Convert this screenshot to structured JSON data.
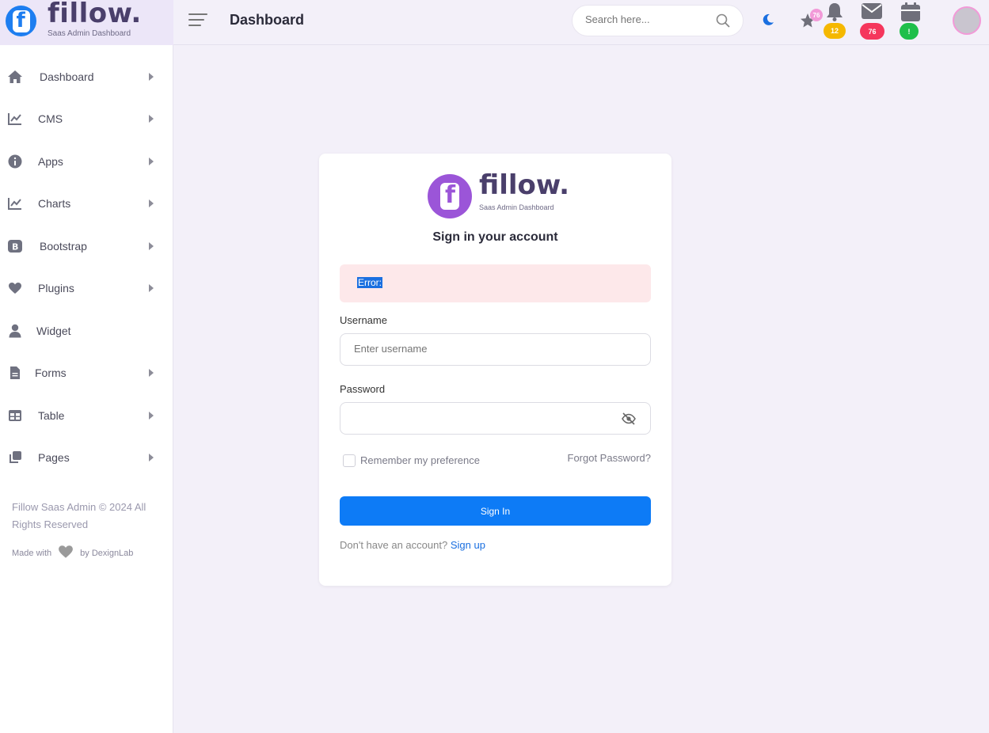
{
  "brand": {
    "name": "fillow.",
    "tagline": "Saas Admin Dashboard"
  },
  "header": {
    "title": "Dashboard",
    "search_placeholder": "Search here...",
    "badges": {
      "star": "76",
      "bell": "12",
      "mail": "76",
      "calendar": "!"
    },
    "colors": {
      "bell_badge": "#f5b800",
      "mail_badge": "#f5365c",
      "calendar_badge": "#1fbf4a",
      "star_badge": "#f29ad8"
    }
  },
  "sidebar": {
    "items": [
      {
        "label": "Dashboard",
        "icon": "home-icon",
        "has_caret": true
      },
      {
        "label": "CMS",
        "icon": "chart-line-icon",
        "has_caret": true
      },
      {
        "label": "Apps",
        "icon": "info-icon",
        "has_caret": true
      },
      {
        "label": "Charts",
        "icon": "chart-line-icon",
        "has_caret": true
      },
      {
        "label": "Bootstrap",
        "icon": "bootstrap-icon",
        "has_caret": true
      },
      {
        "label": "Plugins",
        "icon": "heart-icon",
        "has_caret": true
      },
      {
        "label": "Widget",
        "icon": "user-icon",
        "has_caret": false
      },
      {
        "label": "Forms",
        "icon": "file-icon",
        "has_caret": true
      },
      {
        "label": "Table",
        "icon": "table-icon",
        "has_caret": true
      },
      {
        "label": "Pages",
        "icon": "copy-icon",
        "has_caret": true
      }
    ],
    "footer_copyright": "Fillow Saas Admin © 2024 All Rights Reserved",
    "footer_made_with": "Made with",
    "footer_by": "by DexignLab"
  },
  "card": {
    "brand_name": "fillow.",
    "brand_tagline": "Saas Admin Dashboard",
    "title": "Sign in your account",
    "error_text": "Error:",
    "username_label": "Username",
    "username_placeholder": "Enter username",
    "password_label": "Password",
    "remember_label": "Remember my preference",
    "forgot_label": "Forgot Password?",
    "signin_label": "Sign In",
    "no_account_text": "Don't have an account?",
    "signup_label": "Sign up"
  },
  "colors": {
    "accent": "#0d7bf6",
    "sidebar_bg": "#ffffff",
    "page_bg": "#f3f0f9",
    "error_bg": "#fde8ea"
  }
}
